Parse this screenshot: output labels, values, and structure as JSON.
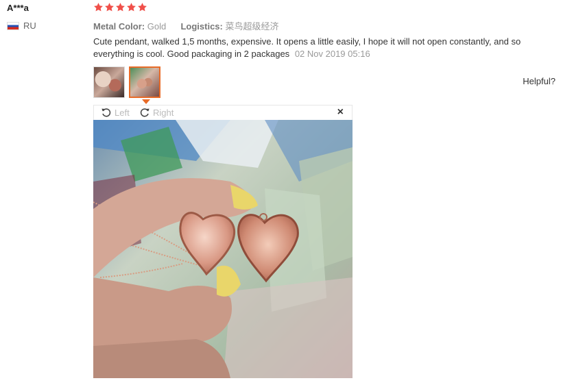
{
  "review": {
    "user": "A***a",
    "country": "RU",
    "rating": 5,
    "attributes": {
      "color_key": "Metal Color:",
      "color_val": "Gold",
      "logistics_key": "Logistics:",
      "logistics_val": "菜鸟超级经济"
    },
    "text": "Cute pendant, walked 1,5 months, expensive. It opens a little easily, I hope it will not open constantly, and so everything is cool. Good packaging in 2 packages",
    "date": "02 Nov 2019 05:16",
    "helpful": "Helpful?"
  },
  "viewer": {
    "rotate_left": "Left",
    "rotate_right": "Right",
    "close": "×"
  },
  "colors": {
    "star": "#f0504a",
    "accent": "#e86b28"
  },
  "icons": [
    "star-icon",
    "flag-ru-icon",
    "rotate-left-icon",
    "rotate-right-icon",
    "close-icon"
  ]
}
